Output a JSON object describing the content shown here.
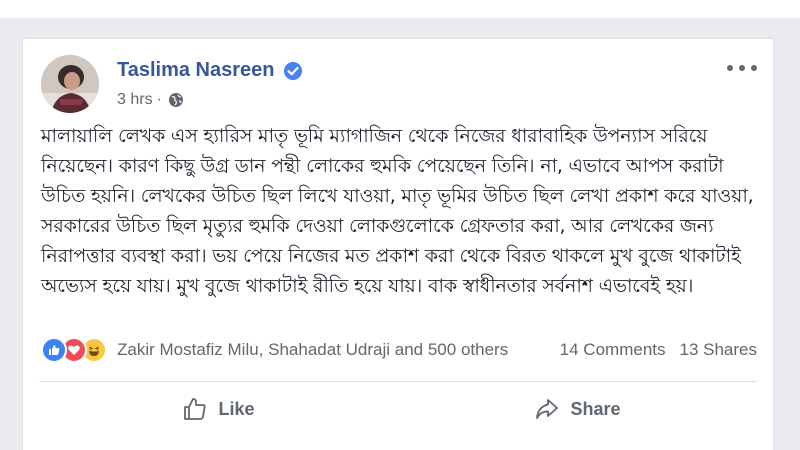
{
  "post": {
    "author": "Taslima Nasreen",
    "time": "3 hrs",
    "dot": "·",
    "text": "মালায়ালি লেখক এস হ্যারিস মাতৃ ভূমি ম্যাগাজিন থেকে নিজের ধারাবাহিক উপন্যাস সরিয়ে নিয়েছেন। কারণ কিছু উগ্র ডান পন্থী লোকের হুমকি পেয়েছেন তিনি। না, এভাবে আপস করাটা উচিত হয়নি। লেখকের উচিত ছিল লিখে যাওয়া, মাতৃ ভূমির উচিত ছিল লেখা প্রকাশ করে যাওয়া, সরকারের উচিত ছিল মৃত্যুর হুমকি দেওয়া লোকগুলোকে গ্রেফতার করা, আর লেখকের জন্য নিরাপত্তার ব্যবস্থা করা। ভয় পেয়ে নিজের মত প্রকাশ করা থেকে বিরত থাকলে মুখ বুজে থাকাটাই অভ্যেস হয়ে যায়। মুখ বুজে থাকাটাই রীতি হয়ে যায়। বাক স্বাধীনতার সর্বনাশ এভাবেই হয়।"
  },
  "stats": {
    "reactors": "Zakir Mostafiz Milu, Shahadat Udraji and 500 others",
    "comments": "14 Comments",
    "shares": "13 Shares"
  },
  "actions": {
    "like_label": "Like",
    "share_label": "Share"
  },
  "colors": {
    "author_link": "#365899",
    "verified": "#4a80f5",
    "like_reaction": "#3b82f6",
    "love_reaction": "#ef4b5f",
    "haha_reaction": "#f7c843"
  },
  "icons": [
    "verified-badge-icon",
    "globe-icon",
    "more-options-icon",
    "like-reaction-icon",
    "love-reaction-icon",
    "haha-reaction-icon",
    "thumbs-up-icon",
    "share-arrow-icon"
  ]
}
